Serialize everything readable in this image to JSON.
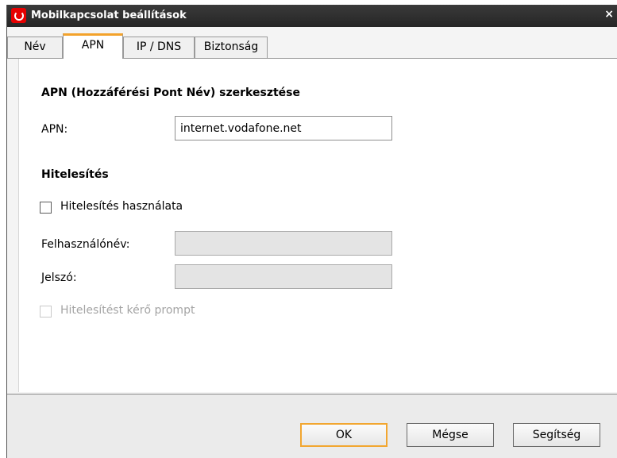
{
  "window": {
    "title": "Mobilkapcsolat beállítások",
    "close_glyph": "×"
  },
  "tabs": [
    {
      "label": "Név",
      "active": false
    },
    {
      "label": "APN",
      "active": true
    },
    {
      "label": "IP / DNS",
      "active": false
    },
    {
      "label": "Biztonság",
      "active": false
    }
  ],
  "apn_section": {
    "heading": "APN (Hozzáférési Pont Név) szerkesztése",
    "apn_label": "APN:",
    "apn_value": "internet.vodafone.net"
  },
  "auth_section": {
    "heading": "Hitelesítés",
    "use_auth_label": "Hitelesítés használata",
    "use_auth_checked": false,
    "username_label": "Felhasználónév:",
    "username_value": "",
    "password_label": "Jelszó:",
    "password_value": "",
    "prompt_label": "Hitelesítést kérő prompt",
    "prompt_checked": false,
    "prompt_enabled": false
  },
  "buttons": {
    "ok": "OK",
    "cancel": "Mégse",
    "help": "Segítség"
  },
  "colors": {
    "accent": "#f2a630",
    "brand": "#e60000",
    "titlebar": "#2e2e2e"
  }
}
